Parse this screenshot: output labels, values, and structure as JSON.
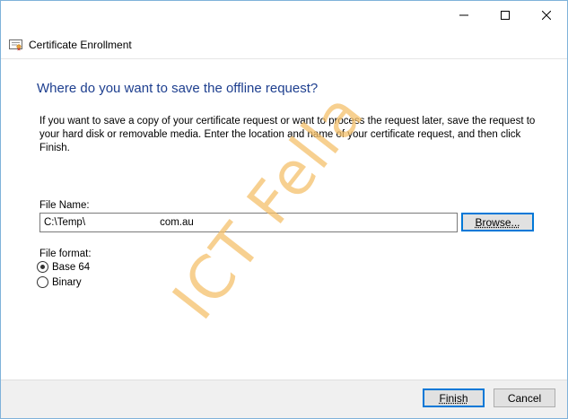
{
  "window": {
    "title": "Certificate Enrollment",
    "controls": {
      "minimize_icon": "minimize-icon",
      "maximize_icon": "maximize-icon",
      "close_icon": "close-icon"
    }
  },
  "page": {
    "heading": "Where do you want to save the offline request?",
    "description": "If you want to save a copy of your certificate request or want to process the request later, save the request to your hard disk or removable media. Enter the location and name of your certificate request, and then click Finish."
  },
  "file": {
    "label": "File Name:",
    "value": "C:\\Temp\\                          com.au",
    "browse_label": "Browse..."
  },
  "format": {
    "label": "File format:",
    "options": [
      {
        "label": "Base 64",
        "selected": true
      },
      {
        "label": "Binary",
        "selected": false
      }
    ]
  },
  "watermark": {
    "text": "ICT Fella",
    "color": "#f5c16b"
  },
  "footer": {
    "finish_label": "Finish",
    "cancel_label": "Cancel"
  },
  "colors": {
    "accent": "#0078d7",
    "heading": "#1e3f8f",
    "border": "#7fb2da"
  }
}
